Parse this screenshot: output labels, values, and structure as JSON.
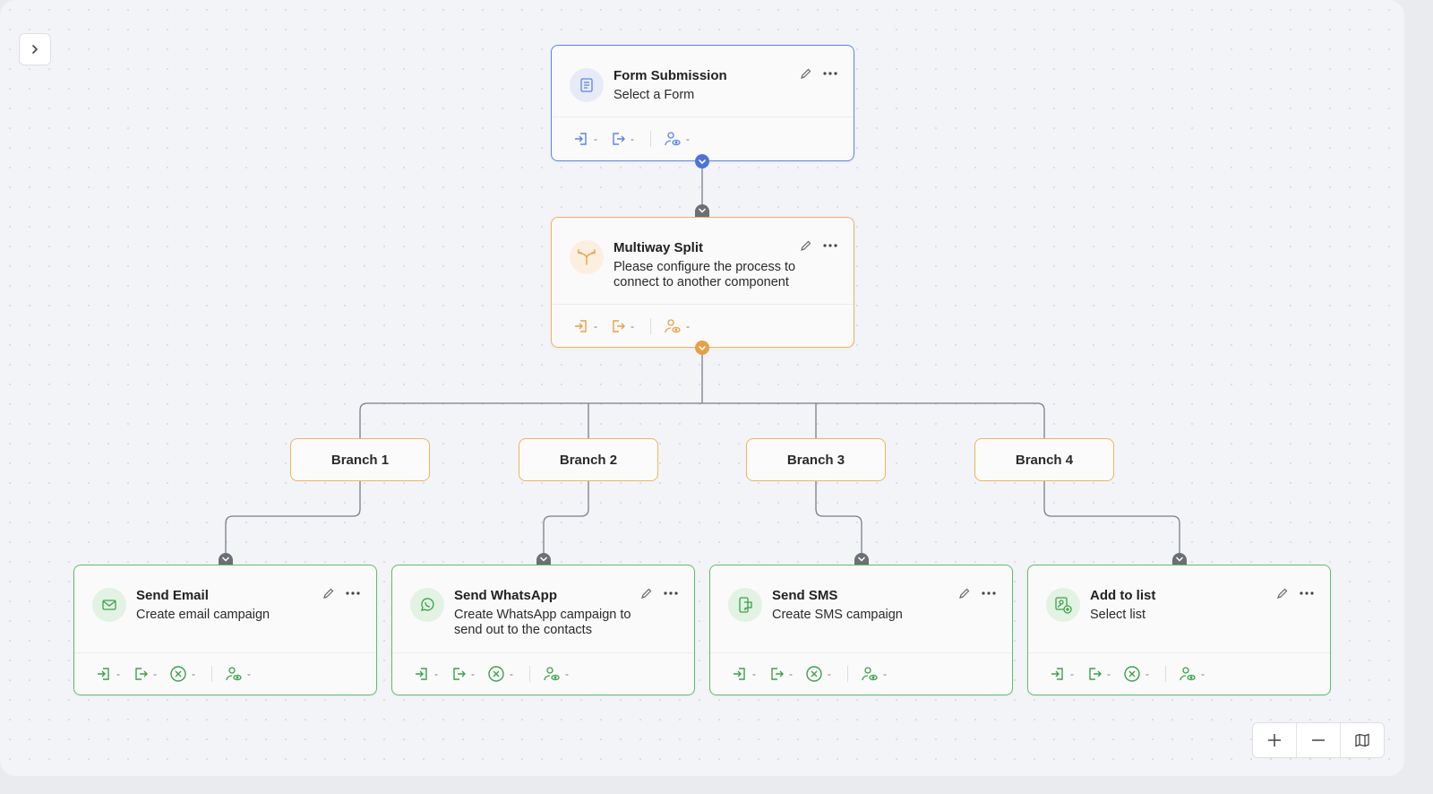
{
  "colors": {
    "blue": "#5b84e6",
    "orange": "#f1b35a",
    "green": "#5cbf6b",
    "connector": "#6b6f76",
    "wire": "#7a7e86"
  },
  "toolbar": {
    "toggle_icon": "chevron-right-icon",
    "zoom_in_icon": "plus-icon",
    "zoom_out_icon": "minus-icon",
    "map_icon": "map-icon"
  },
  "nodes": {
    "form_submission": {
      "title": "Form Submission",
      "desc": "Select a Form",
      "icon": "form-icon",
      "stats": {
        "entered": "-",
        "exited": "-",
        "viewed": "-"
      }
    },
    "multiway_split": {
      "title": "Multiway Split",
      "desc": "Please configure the process to connect to another component",
      "icon": "split-arrow-icon",
      "stats": {
        "entered": "-",
        "exited": "-",
        "viewed": "-"
      }
    },
    "send_email": {
      "title": "Send Email",
      "desc": "Create email campaign",
      "icon": "mail-icon",
      "stats": {
        "entered": "-",
        "exited": "-",
        "failed": "-",
        "viewed": "-"
      }
    },
    "send_whatsapp": {
      "title": "Send WhatsApp",
      "desc": "Create WhatsApp campaign to send out to the contacts",
      "icon": "whatsapp-icon",
      "stats": {
        "entered": "-",
        "exited": "-",
        "failed": "-",
        "viewed": "-"
      }
    },
    "send_sms": {
      "title": "Send SMS",
      "desc": "Create SMS campaign",
      "icon": "sms-icon",
      "stats": {
        "entered": "-",
        "exited": "-",
        "failed": "-",
        "viewed": "-"
      }
    },
    "add_to_list": {
      "title": "Add to list",
      "desc": "Select list",
      "icon": "add-list-icon",
      "stats": {
        "entered": "-",
        "exited": "-",
        "failed": "-",
        "viewed": "-"
      }
    }
  },
  "branches": [
    "Branch 1",
    "Branch 2",
    "Branch 3",
    "Branch 4"
  ]
}
